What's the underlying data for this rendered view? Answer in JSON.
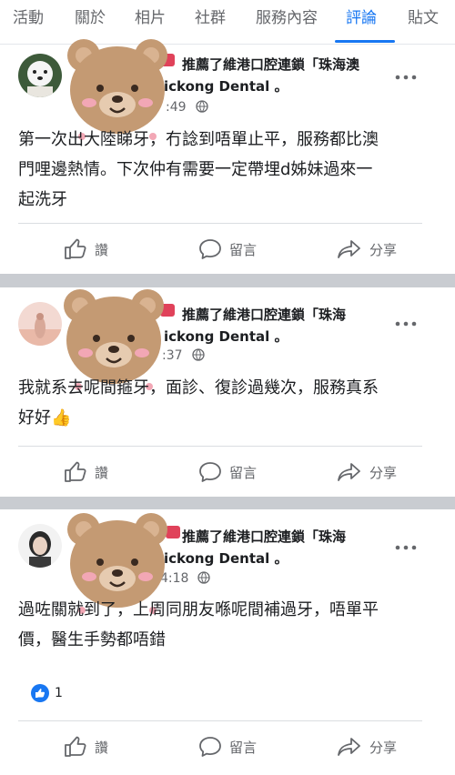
{
  "tabs": [
    {
      "label": "活動"
    },
    {
      "label": "關於"
    },
    {
      "label": "相片"
    },
    {
      "label": "社群"
    },
    {
      "label": "服務內容"
    },
    {
      "label": "評論",
      "active": true
    },
    {
      "label": "貼文"
    }
  ],
  "posts": [
    {
      "header_line1": "推薦了維港口腔連鎖「珠海澳",
      "header_line2": "ickong Dental 。",
      "time": ":49",
      "text": "第一次出大陸睇牙，冇諗到唔單止平，服務都比澳\n門哩邊熱情。下次仲有需要一定帶埋d姊妹過來一\n起洗牙",
      "actions": {
        "like": "讚",
        "comment": "留言",
        "share": "分享"
      }
    },
    {
      "header_line1": "推薦了維港口腔連鎖「珠海",
      "header_line2": "ickong Dental 。",
      "time": ":37",
      "text": "我就系去呢間箍牙，面診、復診過幾次，服務真系\n好好👍",
      "actions": {
        "like": "讚",
        "comment": "留言",
        "share": "分享"
      }
    },
    {
      "header_line1": "推薦了維港口腔連鎖「珠海",
      "header_line2": "ickong Dental 。",
      "time": "4:18",
      "text": "過咗關就到了，上周同朋友喺呢間補過牙，唔單平\n價，醫生手勢都唔錯",
      "reaction_count": "1",
      "actions": {
        "like": "讚",
        "comment": "留言",
        "share": "分享"
      }
    }
  ],
  "colors": {
    "accent": "#1877f2",
    "muted_text": "#65676b",
    "separator": "#c9ccd1",
    "bear_fur": "#c49a73"
  },
  "icons": [
    "thumbs-up-icon",
    "comment-bubble-icon",
    "share-arrow-icon",
    "globe-icon",
    "more-dots-icon",
    "bear-sticker-icon"
  ]
}
